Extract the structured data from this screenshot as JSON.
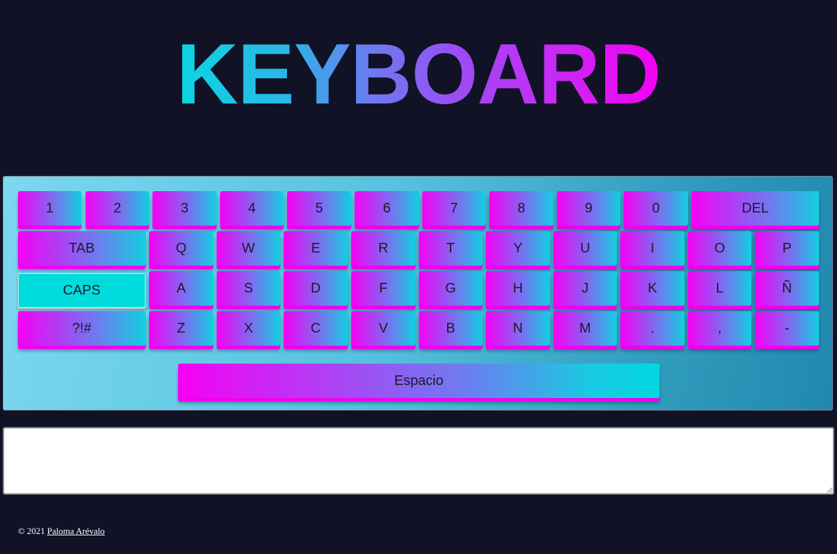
{
  "header": {
    "title": "KEYBOARD"
  },
  "keyboard": {
    "rows": [
      [
        "1",
        "2",
        "3",
        "4",
        "5",
        "6",
        "7",
        "8",
        "9",
        "0",
        "DEL"
      ],
      [
        "TAB",
        "Q",
        "W",
        "E",
        "R",
        "T",
        "Y",
        "U",
        "I",
        "O",
        "P"
      ],
      [
        "CAPS",
        "A",
        "S",
        "D",
        "F",
        "G",
        "H",
        "J",
        "K",
        "L",
        "Ñ"
      ],
      [
        "?!#",
        "Z",
        "X",
        "C",
        "V",
        "B",
        "N",
        "M",
        ".",
        ",",
        "-"
      ]
    ],
    "space_label": "Espacio",
    "caps_active": true
  },
  "output": {
    "value": "",
    "placeholder": ""
  },
  "footer": {
    "copyright": "© 2021",
    "author": "Paloma Arévalo"
  },
  "colors": {
    "background": "#111226",
    "key_gradient_start": "#f600f4",
    "key_gradient_end": "#12cfe0",
    "caps_active": "#00dcdc",
    "panel_light": "#7bd8ef",
    "panel_dark": "#2188ad"
  }
}
